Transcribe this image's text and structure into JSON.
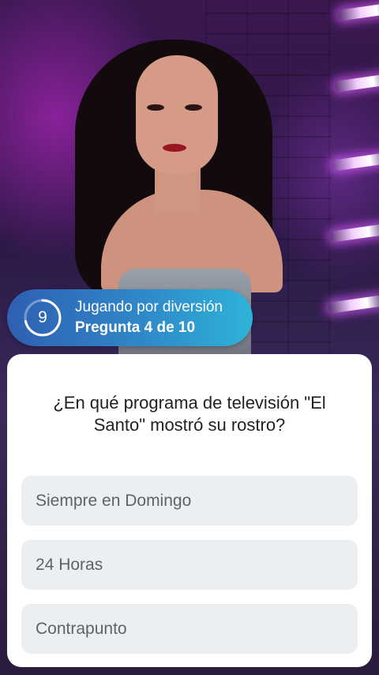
{
  "status": {
    "timer_value": "9",
    "mode": "Jugando por diversión",
    "progress": "Pregunta 4 de 10"
  },
  "question": {
    "text": "¿En qué programa de televisión \"El Santo\" mostró su rostro?"
  },
  "answers": [
    {
      "label": "Siempre en Domingo"
    },
    {
      "label": "24 Horas"
    },
    {
      "label": "Contrapunto"
    }
  ]
}
